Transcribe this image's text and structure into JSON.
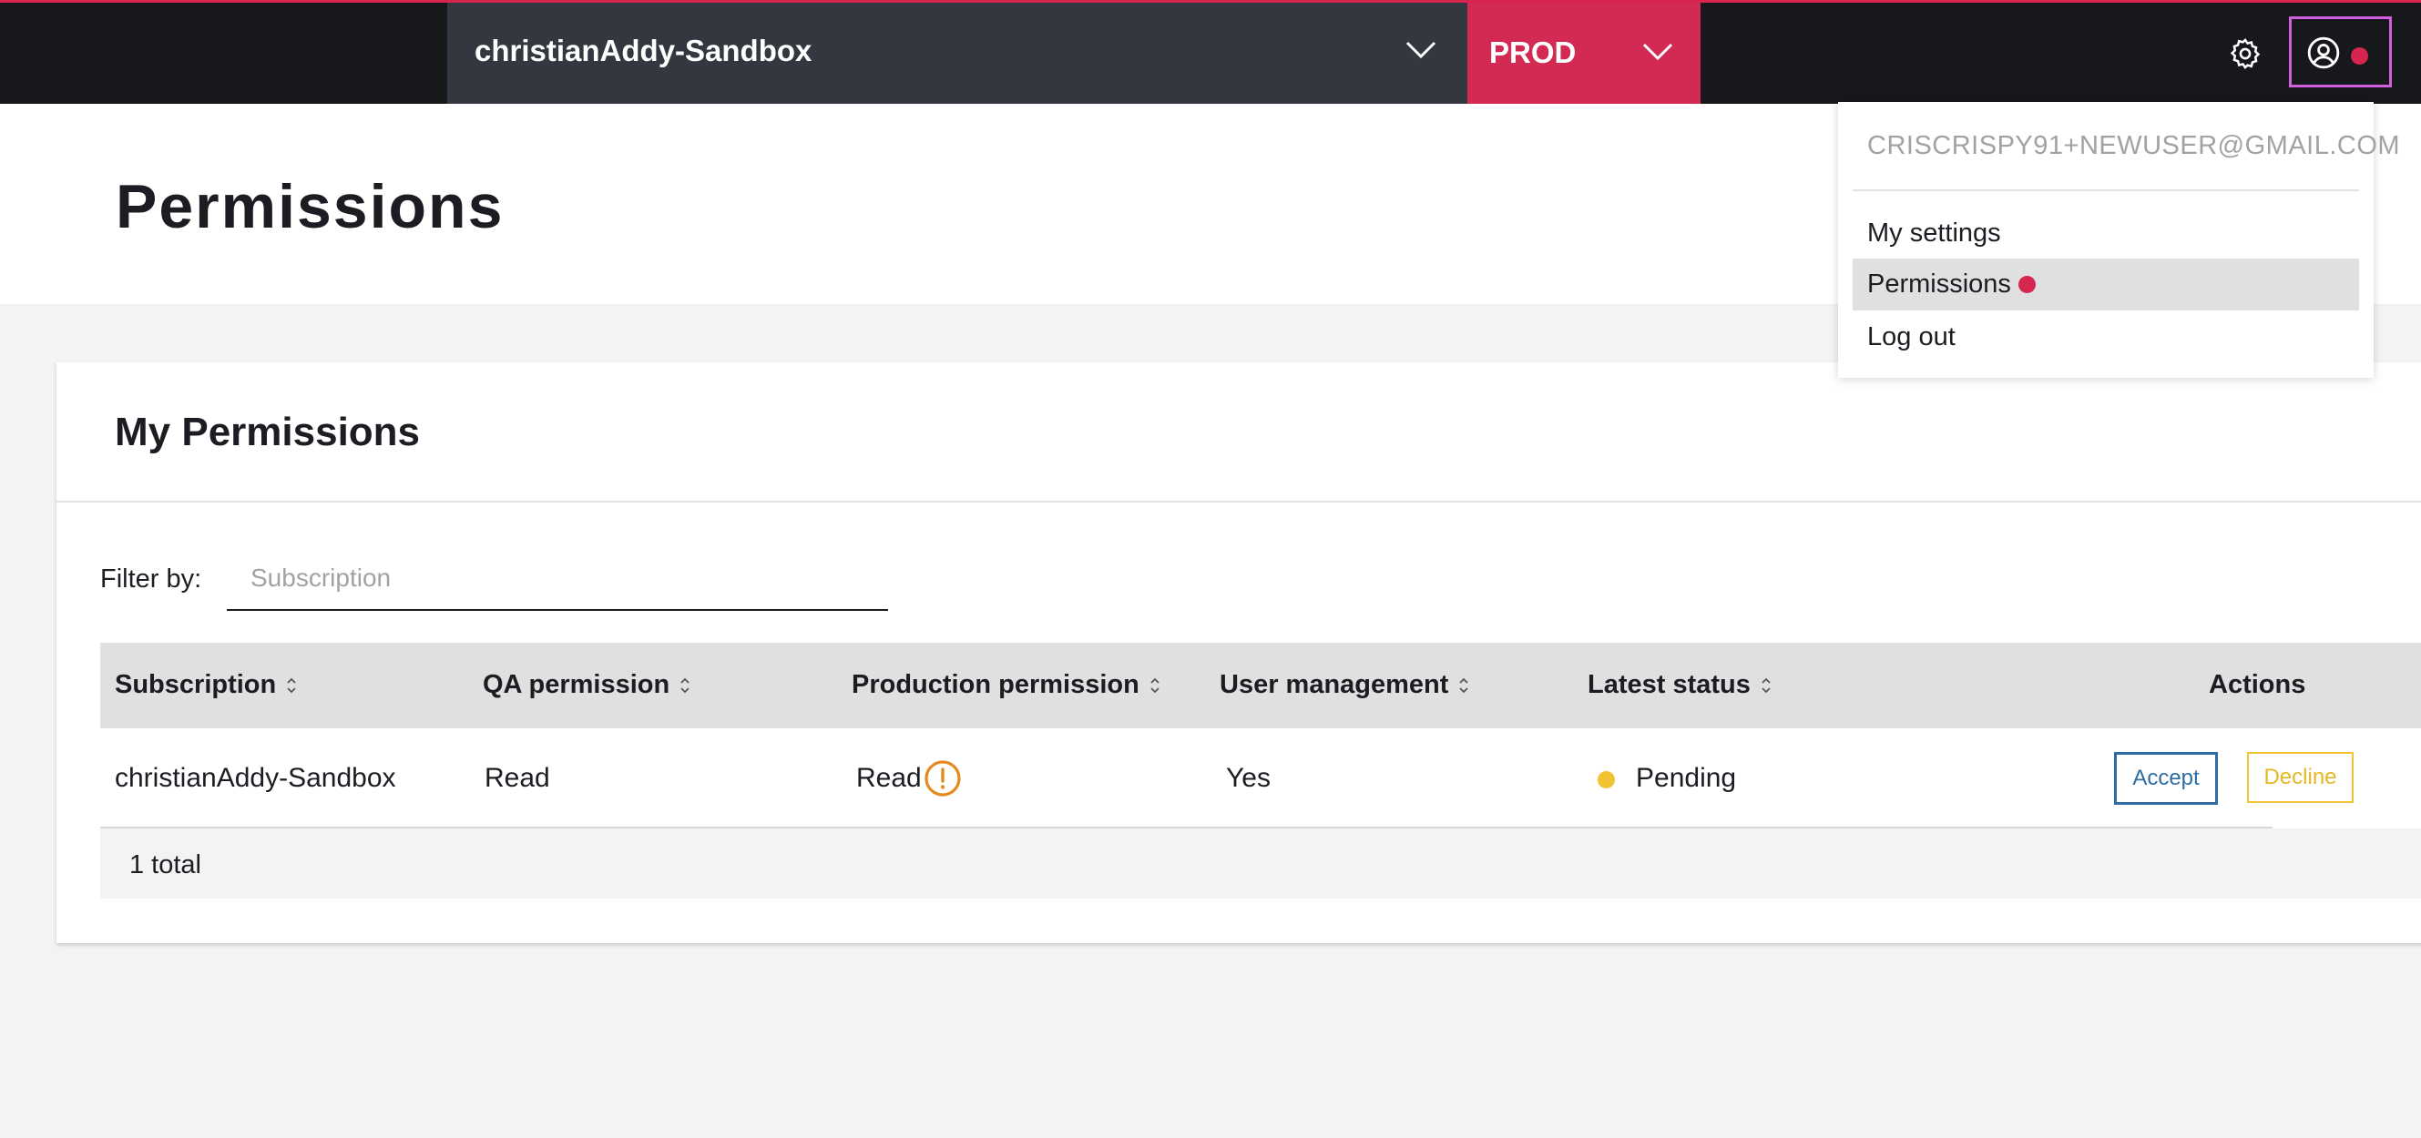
{
  "topbar": {
    "environment": "christianAddy-Sandbox",
    "stage": "PROD",
    "accent_color": "#d22a52",
    "icons": [
      "chevron-down-icon",
      "gear-icon",
      "user-circle-icon"
    ]
  },
  "page": {
    "title": "Permissions"
  },
  "card": {
    "title": "My Permissions",
    "filter": {
      "label": "Filter by:",
      "placeholder": "Subscription",
      "value": ""
    },
    "table": {
      "columns": [
        "Subscription",
        "QA permission",
        "Production permission",
        "User management",
        "Latest status",
        "Actions"
      ],
      "rows": [
        {
          "subscription": "christianAddy-Sandbox",
          "qa_permission": "Read",
          "production_permission": "Read",
          "user_management": "Yes",
          "latest_status": "Pending",
          "status_color": "#f1c232",
          "actions": {
            "accept": "Accept",
            "decline": "Decline"
          }
        }
      ],
      "footer": "1 total"
    }
  },
  "user_menu": {
    "email": "CRISCRISPY91+NEWUSER@GMAIL.COM",
    "items": [
      {
        "label": "My settings"
      },
      {
        "label": "Permissions",
        "active": true
      },
      {
        "label": "Log out"
      }
    ]
  }
}
